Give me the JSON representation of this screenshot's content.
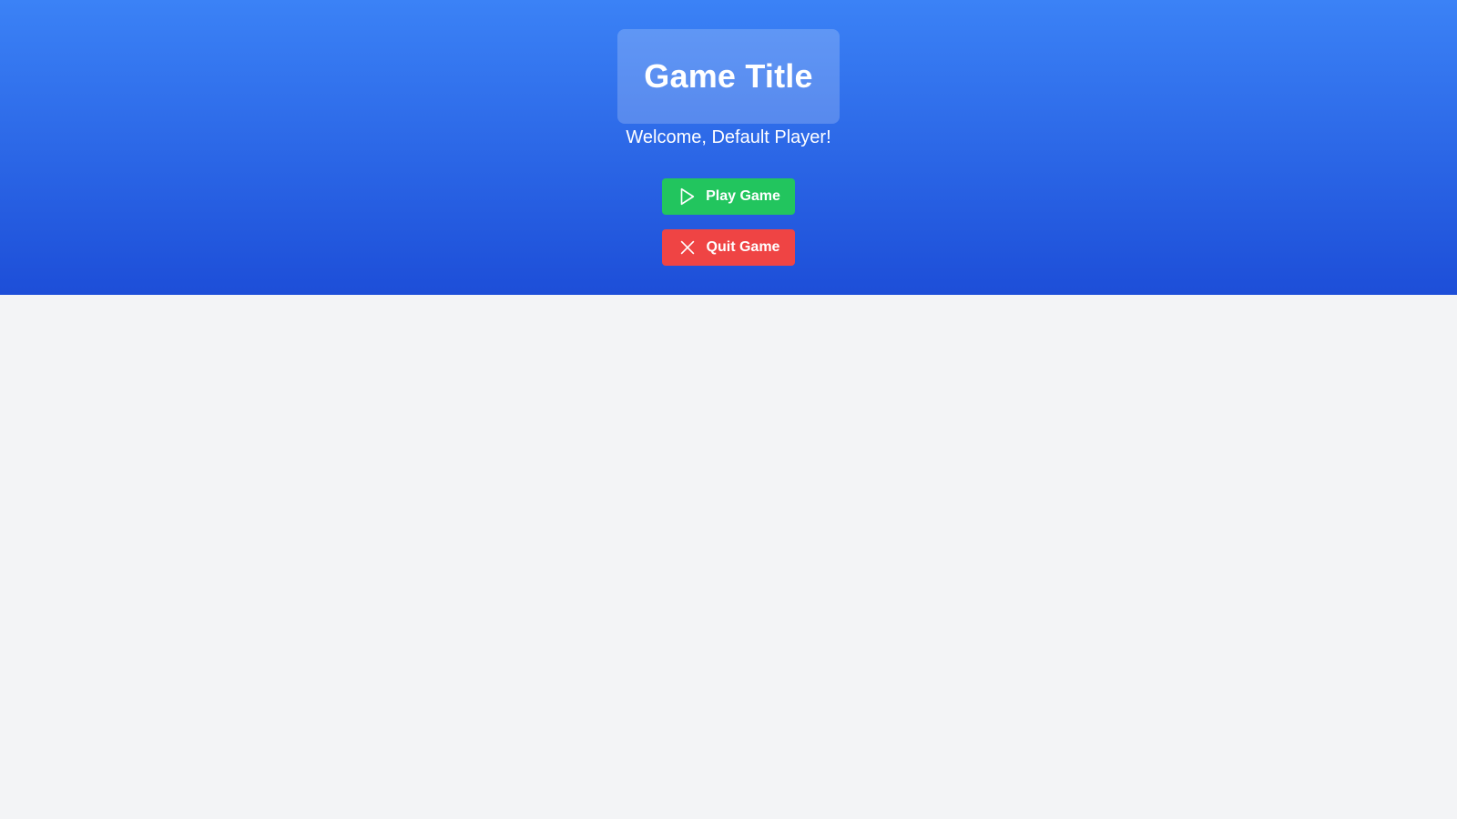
{
  "header": {
    "title": "Game Title",
    "welcome": "Welcome, Default Player!"
  },
  "menu": {
    "play_label": "Play Game",
    "play_icon": "play-icon",
    "quit_label": "Quit Game",
    "quit_icon": "close-icon"
  },
  "colors": {
    "gradient_top": "#3b82f6",
    "gradient_bottom": "#1d4ed8",
    "play": "#22c55e",
    "quit": "#ef4444",
    "background": "#f3f4f6"
  }
}
